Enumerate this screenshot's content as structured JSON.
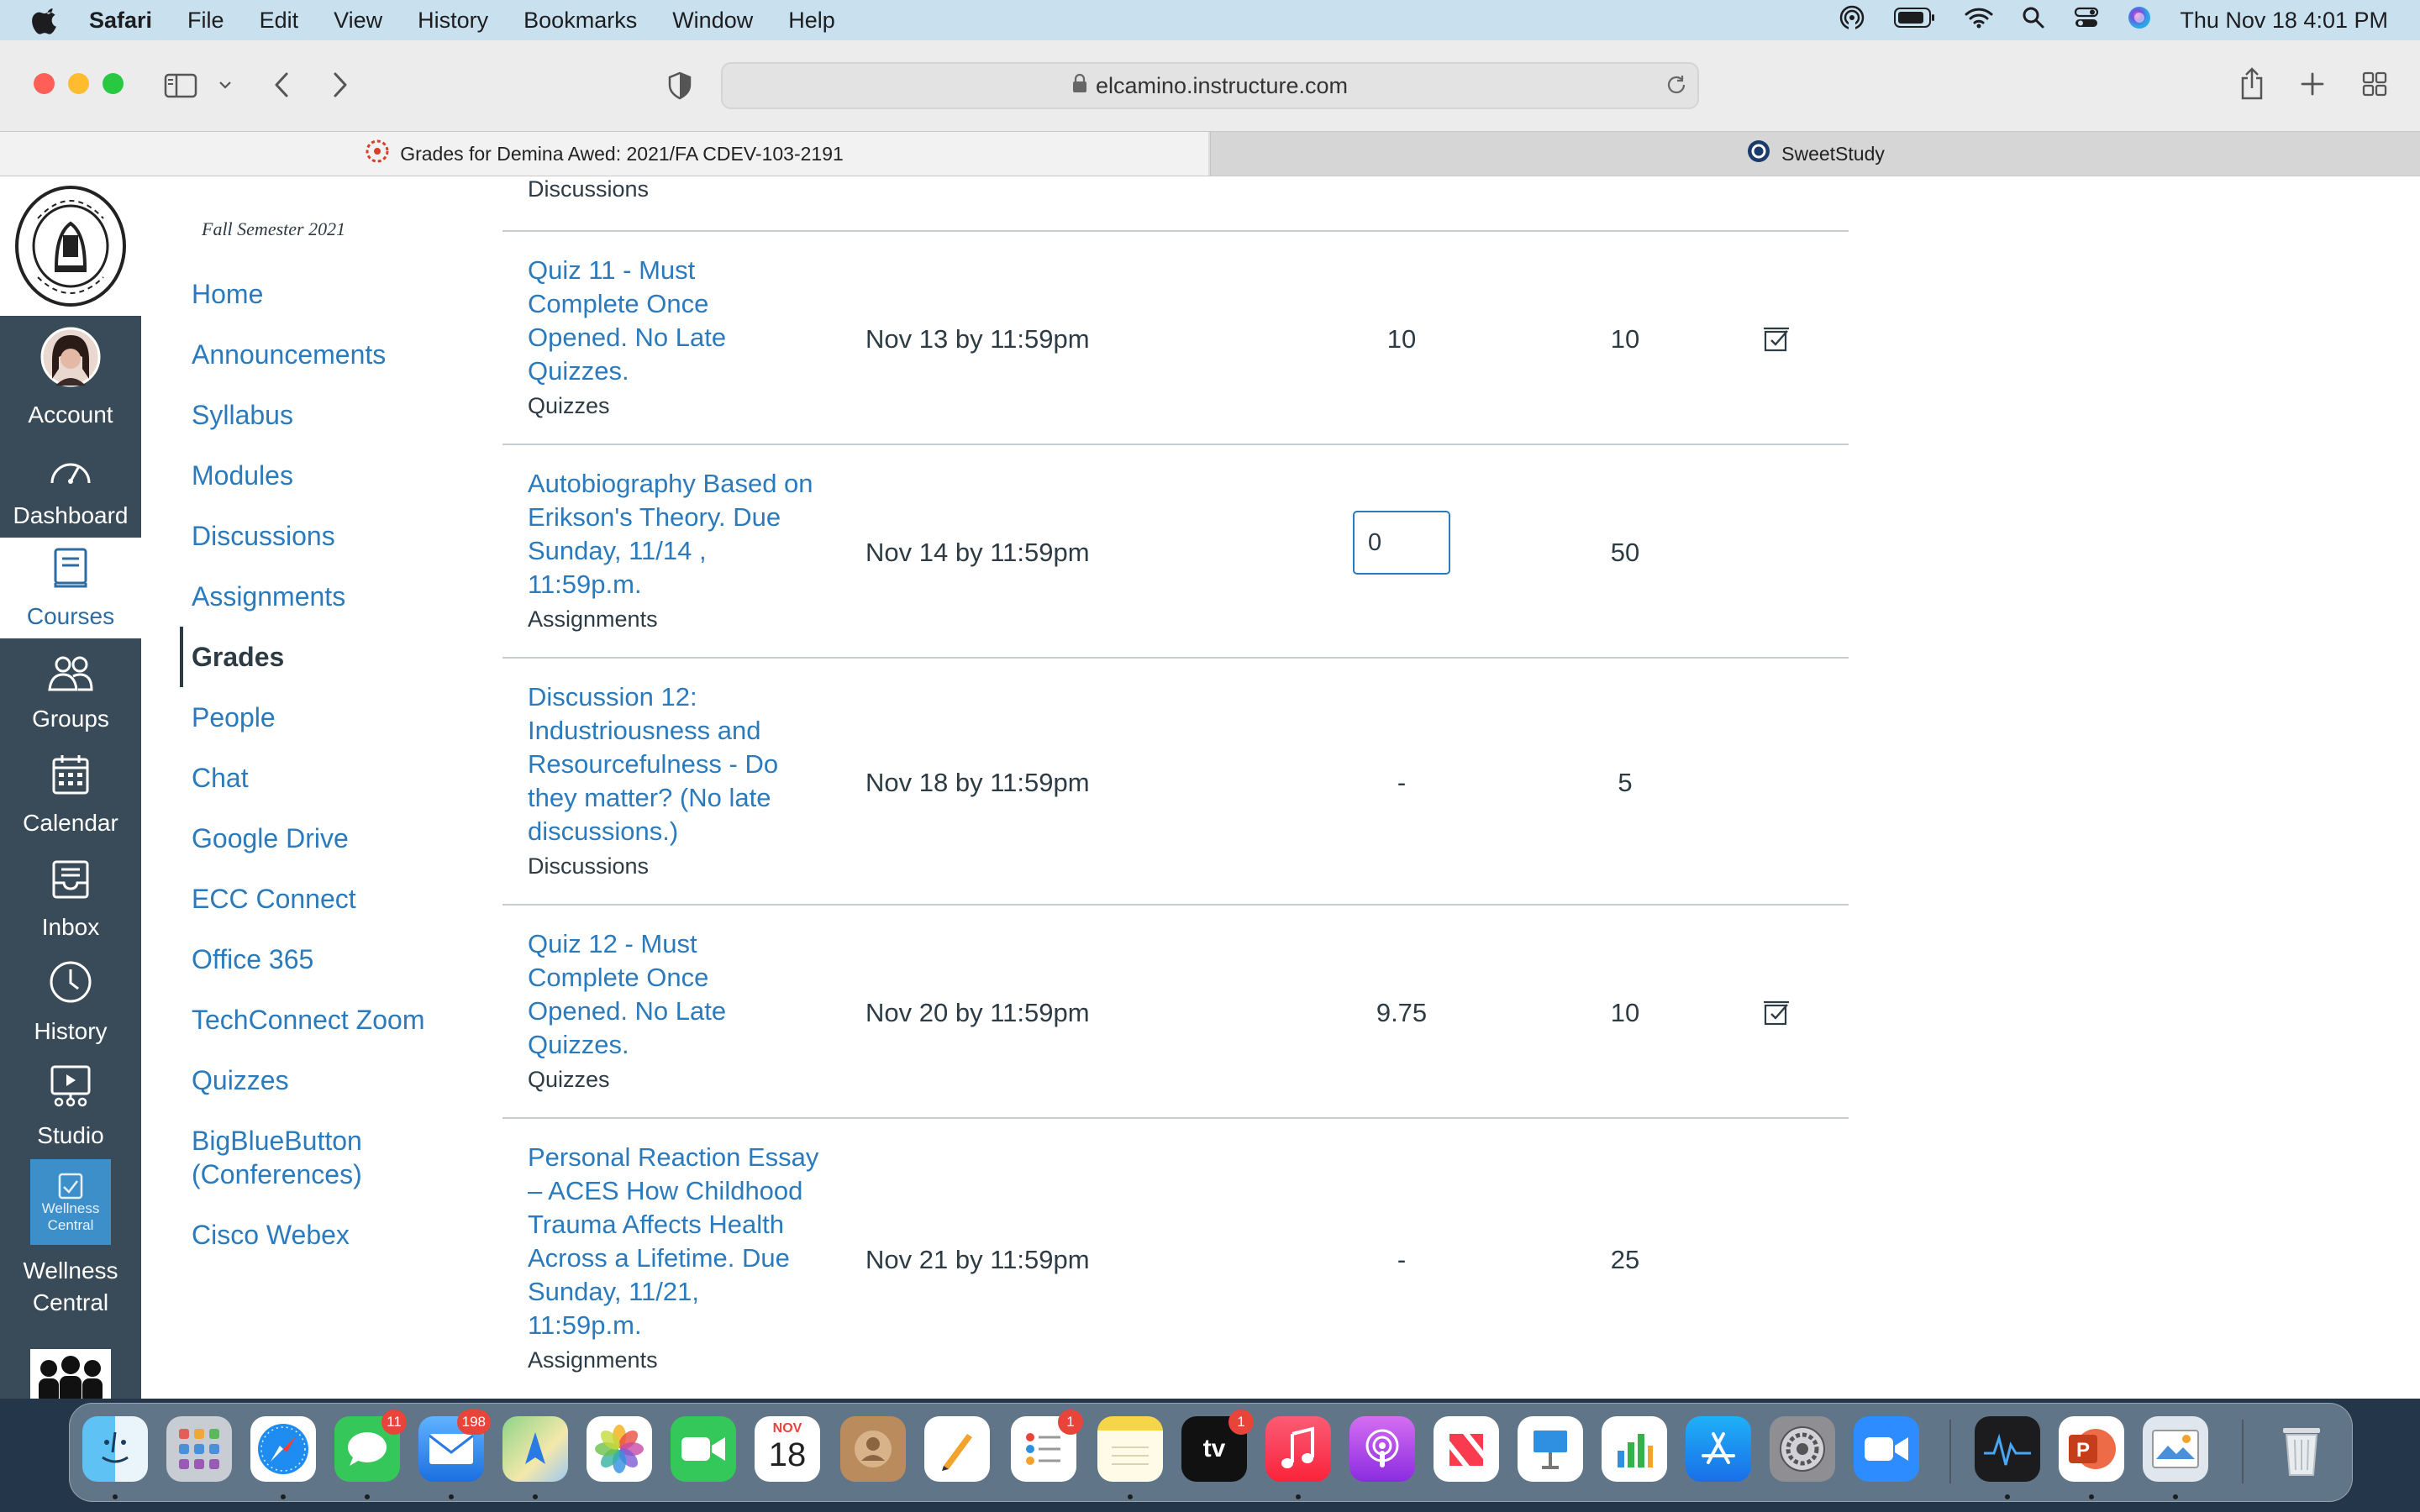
{
  "menubar": {
    "app_name": "Safari",
    "menus": [
      "File",
      "Edit",
      "View",
      "History",
      "Bookmarks",
      "Window",
      "Help"
    ],
    "clock": "Thu Nov 18  4:01 PM"
  },
  "browser": {
    "url": "elcamino.instructure.com",
    "tabs": [
      {
        "label": "Grades for Demina Awed: 2021/FA CDEV-103-2191"
      },
      {
        "label": "SweetStudy"
      }
    ]
  },
  "global_nav": {
    "logo_alt": "El Camino College",
    "items": [
      {
        "label": "Account"
      },
      {
        "label": "Dashboard"
      },
      {
        "label": "Courses"
      },
      {
        "label": "Groups"
      },
      {
        "label": "Calendar"
      },
      {
        "label": "Inbox"
      },
      {
        "label": "History"
      },
      {
        "label": "Studio"
      },
      {
        "label": "Wellness Central",
        "tile_line1": "Wellness",
        "tile_line2": "Central"
      }
    ]
  },
  "course_nav": {
    "term": "Fall Semester 2021",
    "items": [
      {
        "label": "Home"
      },
      {
        "label": "Announcements"
      },
      {
        "label": "Syllabus"
      },
      {
        "label": "Modules"
      },
      {
        "label": "Discussions"
      },
      {
        "label": "Assignments"
      },
      {
        "label": "Grades"
      },
      {
        "label": "People"
      },
      {
        "label": "Chat"
      },
      {
        "label": "Google Drive"
      },
      {
        "label": "ECC Connect"
      },
      {
        "label": "Office 365"
      },
      {
        "label": "TechConnect Zoom"
      },
      {
        "label": "Quizzes"
      },
      {
        "label": "BigBlueButton (Conferences)"
      },
      {
        "label": "Cisco Webex"
      }
    ],
    "active": "Grades"
  },
  "grades": {
    "partial_top_type": "Discussions",
    "rows": [
      {
        "title_lines": [
          "Quiz 11 - Must",
          "Complete Once",
          "Opened. No Late",
          "Quizzes."
        ],
        "type": "Quizzes",
        "due": "Nov 13 by 11:59pm",
        "score": "10",
        "points": "10",
        "has_icon": true
      },
      {
        "title_lines": [
          "Autobiography Based on",
          "Erikson's Theory. Due",
          "Sunday, 11/14 ,",
          "11:59p.m."
        ],
        "type": "Assignments",
        "due": "Nov 14 by 11:59pm",
        "score_input": "0",
        "points": "50"
      },
      {
        "title_lines": [
          "Discussion 12:",
          "Industriousness and",
          "Resourcefulness - Do",
          "they matter? (No late",
          "discussions.)"
        ],
        "type": "Discussions",
        "due": "Nov 18 by 11:59pm",
        "score": "-",
        "points": "5"
      },
      {
        "title_lines": [
          "Quiz 12 - Must",
          "Complete Once",
          "Opened. No Late",
          "Quizzes."
        ],
        "type": "Quizzes",
        "due": "Nov 20 by 11:59pm",
        "score": "9.75",
        "points": "10",
        "has_icon": true
      },
      {
        "title_lines": [
          "Personal Reaction Essay",
          "– ACES How Childhood",
          "Trauma Affects Health",
          "Across a Lifetime. Due",
          "Sunday, 11/21,",
          "11:59p.m."
        ],
        "type": "Assignments",
        "due": "Nov 21 by 11:59pm",
        "score": "-",
        "points": "25"
      }
    ]
  },
  "dock": {
    "calendar_month": "NOV",
    "calendar_day": "18",
    "messages_badge": "11",
    "mail_badge": "198",
    "reminders_badge": "1",
    "tv_badge": "1",
    "tv_label": "tv"
  },
  "colors": {
    "canvas_link": "#2b7abc",
    "global_nav_bg": "#394b58",
    "text": "#2d3b45"
  }
}
